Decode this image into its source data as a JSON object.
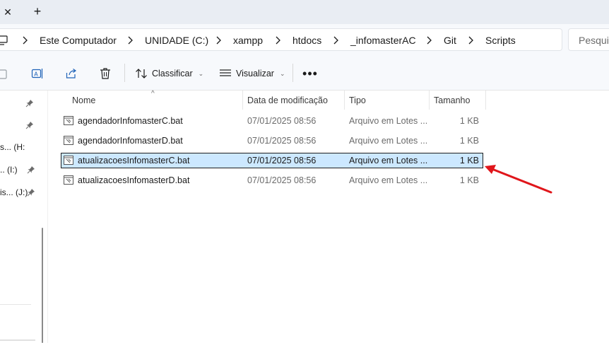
{
  "tabstrip": {
    "close_glyph": "✕",
    "add_glyph": "+"
  },
  "breadcrumb": [
    "Este Computador",
    "UNIDADE (C:)",
    "xampp",
    "htdocs",
    "_infomasterAC",
    "Git",
    "Scripts"
  ],
  "search": {
    "placeholder": "Pesquis"
  },
  "toolbar": {
    "sort_label": "Classificar",
    "view_label": "Visualizar",
    "more_label": "•••",
    "icons": [
      "copy-icon",
      "rename-icon",
      "share-icon",
      "delete-icon",
      "sort-icon",
      "view-icon"
    ]
  },
  "nav": {
    "items": [
      {
        "label": "",
        "pinned": true
      },
      {
        "label": "",
        "pinned": true
      },
      {
        "label": "s... (H:",
        "pinned": false
      },
      {
        "label": ".. (I:)",
        "pinned": true
      },
      {
        "label": "is... (J:)",
        "pinned": true
      }
    ]
  },
  "columns": {
    "name": "Nome",
    "date": "Data de modificação",
    "type": "Tipo",
    "size": "Tamanho"
  },
  "files": [
    {
      "name": "agendadorInfomasterC.bat",
      "date": "07/01/2025 08:56",
      "type": "Arquivo em Lotes ...",
      "size": "1 KB",
      "selected": false
    },
    {
      "name": "agendadorInfomasterD.bat",
      "date": "07/01/2025 08:56",
      "type": "Arquivo em Lotes ...",
      "size": "1 KB",
      "selected": false
    },
    {
      "name": "atualizacoesInfomasterC.bat",
      "date": "07/01/2025 08:56",
      "type": "Arquivo em Lotes ...",
      "size": "1 KB",
      "selected": true
    },
    {
      "name": "atualizacoesInfomasterD.bat",
      "date": "07/01/2025 08:56",
      "type": "Arquivo em Lotes ...",
      "size": "1 KB",
      "selected": false
    }
  ],
  "colors": {
    "accent": "#cce8ff",
    "annotation": "#e0161b"
  }
}
